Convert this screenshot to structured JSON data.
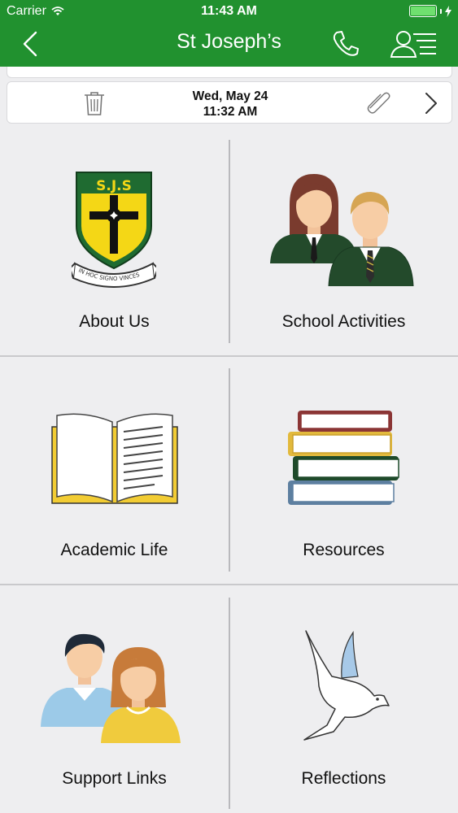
{
  "status_bar": {
    "carrier": "Carrier",
    "time": "11:43 AM"
  },
  "nav": {
    "title": "St Joseph’s"
  },
  "message": {
    "date": "Wed, May 24",
    "time": "11:32 AM"
  },
  "crest": {
    "text": "S.J.S",
    "motto": "IN HOC SIGNO VINCES"
  },
  "tiles": [
    {
      "label": "About Us",
      "icon": "school-crest-icon"
    },
    {
      "label": "School Activities",
      "icon": "students-icon"
    },
    {
      "label": "Academic Life",
      "icon": "open-book-icon"
    },
    {
      "label": "Resources",
      "icon": "book-stack-icon"
    },
    {
      "label": "Support Links",
      "icon": "parents-icon"
    },
    {
      "label": "Reflections",
      "icon": "dove-icon"
    }
  ],
  "colors": {
    "brand_green": "#21912f",
    "background": "#eeeef0"
  }
}
